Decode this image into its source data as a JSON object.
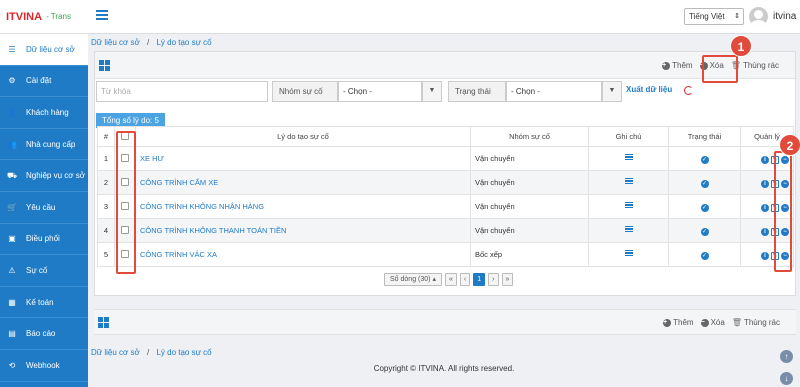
{
  "app": {
    "logo_text": "ITVINA",
    "logo_sub": "- Trans"
  },
  "topbar": {
    "language": "Tiếng Việt",
    "username": "itvina"
  },
  "sidebar": {
    "items": [
      {
        "label": "Dữ liệu cơ sở",
        "icon": "list-icon",
        "active": true
      },
      {
        "label": "Cài đặt",
        "icon": "gear-icon"
      },
      {
        "label": "Khách hàng",
        "icon": "user-icon"
      },
      {
        "label": "Nhà cung cấp",
        "icon": "users-icon"
      },
      {
        "label": "Nghiệp vụ cơ sở",
        "icon": "truck-icon"
      },
      {
        "label": "Yêu cầu",
        "icon": "cart-icon"
      },
      {
        "label": "Điều phối",
        "icon": "box-icon"
      },
      {
        "label": "Sự cố",
        "icon": "alert-icon"
      },
      {
        "label": "Kế toán",
        "icon": "calculator-icon"
      },
      {
        "label": "Báo cáo",
        "icon": "table-icon"
      },
      {
        "label": "Webhook",
        "icon": "webhook-icon"
      }
    ]
  },
  "breadcrumb": {
    "root": "Dữ liệu cơ sở",
    "sep": "/",
    "current": "Lý do tạo sự cố"
  },
  "toolbar": {
    "add": "Thêm",
    "delete": "Xóa",
    "trash": "Thùng rác"
  },
  "filters": {
    "keyword_placeholder": "Từ khóa",
    "group_label": "Nhóm sự cố",
    "group_value": "- Chọn -",
    "status_label": "Trạng thái",
    "status_value": "- Chọn -",
    "export": "Xuất dữ liệu"
  },
  "summary": {
    "total": "Tổng số lý do: 5"
  },
  "table": {
    "headers": {
      "num": "#",
      "reason": "Lý do tạo sự cố",
      "group": "Nhóm sự cố",
      "note": "Ghi chú",
      "status": "Trạng thái",
      "manage": "Quản lý"
    },
    "rows": [
      {
        "num": "1",
        "reason": "XE HƯ",
        "group": "Vận chuyển"
      },
      {
        "num": "2",
        "reason": "CÔNG TRÌNH CẤM XE",
        "group": "Vận chuyển"
      },
      {
        "num": "3",
        "reason": "CÔNG TRÌNH KHÔNG NHẬN HÀNG",
        "group": "Vận chuyển"
      },
      {
        "num": "4",
        "reason": "CÔNG TRÌNH KHÔNG THANH TOÁN TIỀN",
        "group": "Vận chuyển"
      },
      {
        "num": "5",
        "reason": "CÔNG TRÌNH VÁC XA",
        "group": "Bốc xếp"
      }
    ]
  },
  "pagination": {
    "rows_label": "Số dòng (30)",
    "first": "«",
    "prev": "‹",
    "page": "1",
    "next": "›",
    "last": "»"
  },
  "footer": {
    "copyright": "Copyright © ITVINA. All rights reserved."
  },
  "annotations": {
    "one": "1",
    "two": "2"
  },
  "colors": {
    "primary": "#1f7bc6",
    "highlight": "#e04b3b"
  }
}
